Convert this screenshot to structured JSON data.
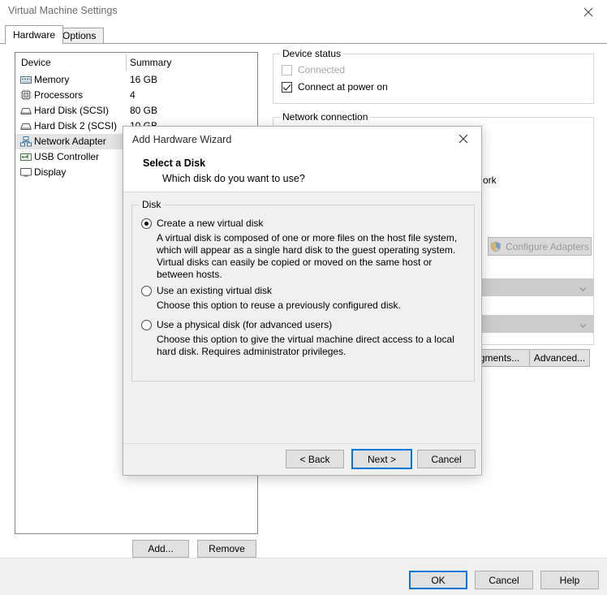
{
  "window": {
    "title": "Virtual Machine Settings",
    "close_icon": "close-icon"
  },
  "tabs": [
    {
      "label": "Hardware",
      "active": true
    },
    {
      "label": "Options",
      "active": false
    }
  ],
  "device_list": {
    "columns": [
      "Device",
      "Summary"
    ],
    "rows": [
      {
        "icon": "memory-icon",
        "name": "Memory",
        "summary": "16 GB",
        "selected": false
      },
      {
        "icon": "processor-icon",
        "name": "Processors",
        "summary": "4",
        "selected": false
      },
      {
        "icon": "hard-disk-icon",
        "name": "Hard Disk (SCSI)",
        "summary": "80 GB",
        "selected": false
      },
      {
        "icon": "hard-disk-icon",
        "name": "Hard Disk 2 (SCSI)",
        "summary": "10 GB",
        "selected": false
      },
      {
        "icon": "network-adapter-icon",
        "name": "Network Adapter",
        "summary": "",
        "selected": true
      },
      {
        "icon": "usb-controller-icon",
        "name": "USB Controller",
        "summary": "",
        "selected": false
      },
      {
        "icon": "display-icon",
        "name": "Display",
        "summary": "",
        "selected": false
      }
    ]
  },
  "list_buttons": {
    "add": "Add...",
    "remove": "Remove"
  },
  "right_panel": {
    "device_status": {
      "legend": "Device status",
      "connected_label": "Connected",
      "connected_checked": false,
      "connected_enabled": false,
      "connect_at_power_on_label": "Connect at power on",
      "connect_at_power_on_checked": true
    },
    "network_connection": {
      "legend": "Network connection",
      "partial_option_text": "ork",
      "configure_adapters_label": "Configure Adapters",
      "configure_adapters_icon": "shield-icon",
      "configure_adapters_enabled": false
    },
    "lan_segments_label": "gments...",
    "advanced_label": "Advanced..."
  },
  "bottom_buttons": {
    "ok": "OK",
    "cancel": "Cancel",
    "help": "Help"
  },
  "wizard": {
    "title": "Add Hardware Wizard",
    "close_icon": "close-icon",
    "heading": "Select a Disk",
    "subheading": "Which disk do you want to use?",
    "group_label": "Disk",
    "options": [
      {
        "label": "Create a new virtual disk",
        "selected": true,
        "description": "A virtual disk is composed of one or more files on the host file system, which will appear as a single hard disk to the guest operating system. Virtual disks can easily be copied or moved on the same host or between hosts."
      },
      {
        "label": "Use an existing virtual disk",
        "selected": false,
        "description": "Choose this option to reuse a previously configured disk."
      },
      {
        "label": "Use a physical disk (for advanced users)",
        "selected": false,
        "description": "Choose this option to give the virtual machine direct access to a local hard disk. Requires administrator privileges."
      }
    ],
    "buttons": {
      "back": "< Back",
      "next": "Next >",
      "cancel": "Cancel"
    }
  },
  "colors": {
    "accent": "#0078d7",
    "dialog_bg": "#f0f0f0",
    "selection": "#e4e4e4",
    "button_face": "#e1e1e1",
    "disabled_text": "#a6a6a6"
  }
}
